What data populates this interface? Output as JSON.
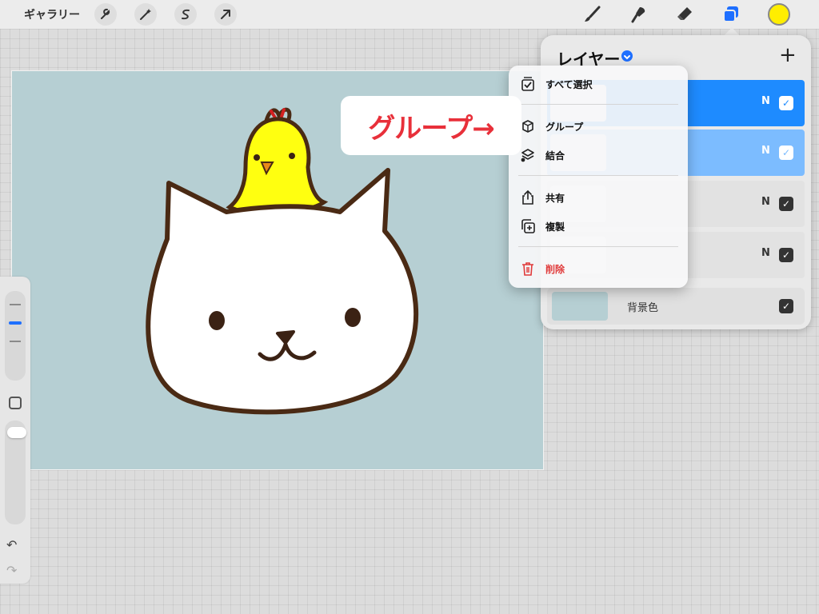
{
  "toolbar": {
    "gallery_label": "ギャラリー",
    "left_tools": [
      "wrench-icon",
      "magic-wand-icon",
      "selection-icon",
      "transform-arrow-icon"
    ],
    "right_tools": [
      "brush-icon",
      "smudge-icon",
      "eraser-icon",
      "layers-icon"
    ],
    "current_color": "#ffee00",
    "accent": "#1e6fff"
  },
  "canvas": {
    "background": "#b6cfd3"
  },
  "sidebar": {
    "size_slider_level": 0.3,
    "opacity_slider_level": 0.1
  },
  "layers_panel": {
    "title": "レイヤー",
    "add_icon": "plus-icon",
    "layers": [
      {
        "mode": "N",
        "selected": "primary",
        "checked": true
      },
      {
        "mode": "N",
        "selected": "secondary",
        "checked": true
      },
      {
        "mode": "N",
        "selected": "none",
        "checked": true
      },
      {
        "mode": "N",
        "selected": "none",
        "checked": true
      }
    ],
    "background_row": {
      "label": "背景色",
      "color": "#b6cfd3",
      "checked": true
    }
  },
  "context_menu": {
    "items": [
      {
        "icon": "select-all-icon",
        "label": "すべて選択"
      },
      {
        "icon": "group-icon",
        "label": "グループ"
      },
      {
        "icon": "combine-icon",
        "label": "結合"
      },
      {
        "icon": "share-icon",
        "label": "共有"
      },
      {
        "icon": "duplicate-icon",
        "label": "複製"
      },
      {
        "icon": "trash-icon",
        "label": "削除",
        "destructive": true
      }
    ]
  },
  "annotation": {
    "text": "グループ→",
    "color": "#e8303a"
  }
}
